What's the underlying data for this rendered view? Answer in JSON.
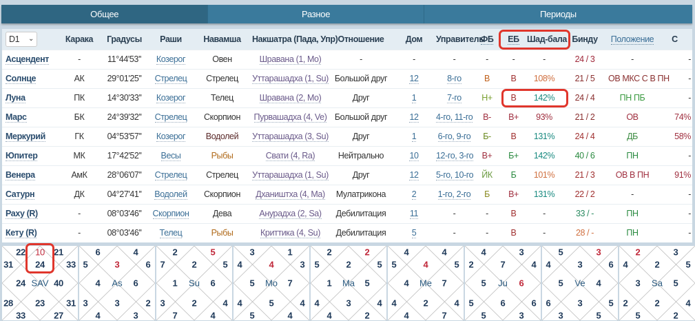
{
  "tabs": [
    {
      "label": "Общее",
      "active": true
    },
    {
      "label": "Разное",
      "active": false
    },
    {
      "label": "Периоды",
      "active": false
    }
  ],
  "division_select": {
    "value": "D1",
    "icon": "chevron-down-icon"
  },
  "columns": [
    "Карака",
    "Градусы",
    "Раши",
    "Навамша",
    "Накшатра (Пада, Упр)",
    "Отношение",
    "Дом",
    "Управитель",
    "ФБ",
    "ЕБ",
    "Шад-бала",
    "Бинду",
    "Положение",
    "С"
  ],
  "rows": [
    {
      "planet": "Асцендент",
      "karaka": "-",
      "deg": "11°44'53''",
      "rashi": "Козерог",
      "navamsha": {
        "t": "Овен",
        "c": "#333333"
      },
      "nakshatra": "Шравана (1, Mo)",
      "relation": "-",
      "house": "-",
      "lord": "-",
      "fb": {
        "t": "-",
        "c": "#333333"
      },
      "eb": {
        "t": "-",
        "c": "#333333"
      },
      "shad": {
        "t": "-",
        "c": "#333333"
      },
      "bindu": {
        "t": "24 / 3",
        "c": "#a0283a"
      },
      "pol": {
        "t": "-",
        "c": "#333333"
      },
      "s": {
        "t": "-",
        "c": "#333333"
      }
    },
    {
      "planet": "Солнце",
      "karaka": "АК",
      "deg": "29°01'25''",
      "rashi": "Стрелец",
      "navamsha": {
        "t": "Стрелец",
        "c": "#333333"
      },
      "nakshatra": "Уттарашадха (1, Su)",
      "relation": "Большой друг",
      "house": "12",
      "lord": "8-го",
      "fb": {
        "t": "В",
        "c": "#c0601a"
      },
      "eb": {
        "t": "В",
        "c": "#a03030"
      },
      "shad": {
        "t": "108%",
        "c": "#d07040"
      },
      "bindu": {
        "t": "21 / 5",
        "c": "#8a3030"
      },
      "pol": {
        "t": "ОВ МКС С В ПН",
        "c": "#8a3030"
      },
      "s": {
        "t": "-",
        "c": "#333333"
      }
    },
    {
      "planet": "Луна",
      "karaka": "ПК",
      "deg": "14°30'33''",
      "rashi": "Козерог",
      "navamsha": {
        "t": "Телец",
        "c": "#333333"
      },
      "nakshatra": "Шравана (2, Mo)",
      "relation": "Друг",
      "house": "1",
      "lord": "7-го",
      "fb": {
        "t": "Н+",
        "c": "#7aa030"
      },
      "eb": {
        "t": "В",
        "c": "#a03030"
      },
      "shad": {
        "t": "142%",
        "c": "#1a8a80"
      },
      "bindu": {
        "t": "24 / 4",
        "c": "#8a3030"
      },
      "pol": {
        "t": "ПН ПБ",
        "c": "#3a9a40"
      },
      "s": {
        "t": "-",
        "c": "#333333"
      }
    },
    {
      "planet": "Марс",
      "karaka": "БК",
      "deg": "24°39'32''",
      "rashi": "Стрелец",
      "navamsha": {
        "t": "Скорпион",
        "c": "#333333"
      },
      "nakshatra": "Пурвашадха (4, Ve)",
      "relation": "Большой друг",
      "house": "12",
      "lord": "4-го, 11-го",
      "fb": {
        "t": "В-",
        "c": "#a03040"
      },
      "eb": {
        "t": "В+",
        "c": "#a03040"
      },
      "shad": {
        "t": "93%",
        "c": "#a03040"
      },
      "bindu": {
        "t": "21 / 2",
        "c": "#8a3030"
      },
      "pol": {
        "t": "ОВ",
        "c": "#a03040"
      },
      "s": {
        "t": "74%",
        "c": "#a03040"
      }
    },
    {
      "planet": "Меркурий",
      "karaka": "ГК",
      "deg": "04°53'57''",
      "rashi": "Козерог",
      "navamsha": {
        "t": "Водолей",
        "c": "#5a2a2a"
      },
      "nakshatra": "Уттарашадха (3, Su)",
      "relation": "Друг",
      "house": "1",
      "lord": "6-го, 9-го",
      "fb": {
        "t": "Б-",
        "c": "#6a8a20"
      },
      "eb": {
        "t": "В",
        "c": "#a03030"
      },
      "shad": {
        "t": "131%",
        "c": "#1a8a80"
      },
      "bindu": {
        "t": "24 / 4",
        "c": "#a03030"
      },
      "pol": {
        "t": "ДБ",
        "c": "#3a8a40"
      },
      "s": {
        "t": "58%",
        "c": "#a03040"
      }
    },
    {
      "planet": "Юпитер",
      "karaka": "МК",
      "deg": "17°42'52''",
      "rashi": "Весы",
      "navamsha": {
        "t": "Рыбы",
        "c": "#b06a1a"
      },
      "nakshatra": "Свати (4, Ra)",
      "relation": "Нейтрально",
      "house": "10",
      "lord": "12-го, 3-го",
      "fb": {
        "t": "В+",
        "c": "#a03040"
      },
      "eb": {
        "t": "Б+",
        "c": "#2a8a40"
      },
      "shad": {
        "t": "142%",
        "c": "#1a8a80"
      },
      "bindu": {
        "t": "40 / 6",
        "c": "#2a8a40"
      },
      "pol": {
        "t": "ПН",
        "c": "#2a8a40"
      },
      "s": {
        "t": "-",
        "c": "#333333"
      }
    },
    {
      "planet": "Венера",
      "karaka": "АмК",
      "deg": "28°06'07''",
      "rashi": "Стрелец",
      "navamsha": {
        "t": "Стрелец",
        "c": "#333333"
      },
      "nakshatra": "Уттарашадха (1, Su)",
      "relation": "Друг",
      "house": "12",
      "lord": "5-го, 10-го",
      "fb": {
        "t": "ЙК",
        "c": "#6a9a40"
      },
      "eb": {
        "t": "Б",
        "c": "#2a8a40"
      },
      "shad": {
        "t": "101%",
        "c": "#d07040"
      },
      "bindu": {
        "t": "21 / 3",
        "c": "#a03030"
      },
      "pol": {
        "t": "ОВ В ПН",
        "c": "#a03040"
      },
      "s": {
        "t": "91%",
        "c": "#a03040"
      }
    },
    {
      "planet": "Сатурн",
      "karaka": "ДК",
      "deg": "04°27'41''",
      "rashi": "Водолей",
      "navamsha": {
        "t": "Скорпион",
        "c": "#333333"
      },
      "nakshatra": "Дхаништха (4, Ma)",
      "relation": "Мулатрикона",
      "house": "2",
      "lord": "1-го, 2-го",
      "fb": {
        "t": "Б",
        "c": "#8a8a20"
      },
      "eb": {
        "t": "В+",
        "c": "#a03040"
      },
      "shad": {
        "t": "131%",
        "c": "#1a8a80"
      },
      "bindu": {
        "t": "22 / 2",
        "c": "#a03030"
      },
      "pol": {
        "t": "-",
        "c": "#333333"
      },
      "s": {
        "t": "-",
        "c": "#333333"
      }
    },
    {
      "planet": "Раху (R)",
      "karaka": "-",
      "deg": "08°03'46''",
      "rashi": "Скорпион",
      "navamsha": {
        "t": "Дева",
        "c": "#333333"
      },
      "nakshatra": "Анурадха (2, Sa)",
      "relation": "Дебилитация",
      "house": "11",
      "lord": "-",
      "fb": {
        "t": "-",
        "c": "#333333"
      },
      "eb": {
        "t": "В",
        "c": "#a03030"
      },
      "shad": {
        "t": "-",
        "c": "#333333"
      },
      "bindu": {
        "t": "33 / -",
        "c": "#2a8a60"
      },
      "pol": {
        "t": "ПН",
        "c": "#2a8a40"
      },
      "s": {
        "t": "-",
        "c": "#333333"
      }
    },
    {
      "planet": "Кету (R)",
      "karaka": "-",
      "deg": "08°03'46''",
      "rashi": "Телец",
      "navamsha": {
        "t": "Рыбы",
        "c": "#b06a1a"
      },
      "nakshatra": "Криттика (4, Su)",
      "relation": "Дебилитация",
      "house": "5",
      "lord": "-",
      "fb": {
        "t": "-",
        "c": "#333333"
      },
      "eb": {
        "t": "В",
        "c": "#a03030"
      },
      "shad": {
        "t": "-",
        "c": "#333333"
      },
      "bindu": {
        "t": "28 / -",
        "c": "#d07040"
      },
      "pol": {
        "t": "ПН",
        "c": "#2a8a40"
      },
      "s": {
        "t": "-",
        "c": "#333333"
      }
    }
  ],
  "charts": [
    {
      "label": "SAV",
      "sign": "10",
      "houses": [
        24,
        22,
        31,
        24,
        28,
        33,
        23,
        27,
        31,
        40,
        33,
        21
      ],
      "red_house": 0
    },
    {
      "label": "As",
      "houses": [
        3,
        6,
        5,
        4,
        3,
        4,
        3,
        3,
        2,
        6,
        6,
        4
      ],
      "red_house": 1
    },
    {
      "label": "Su",
      "houses": [
        2,
        2,
        7,
        1,
        3,
        7,
        2,
        4,
        4,
        6,
        5,
        5
      ],
      "red_house": 12
    },
    {
      "label": "Mo",
      "houses": [
        4,
        3,
        4,
        5,
        4,
        5,
        5,
        4,
        4,
        7,
        3,
        1
      ],
      "red_house": 1
    },
    {
      "label": "Ma",
      "houses": [
        2,
        2,
        5,
        1,
        4,
        4,
        3,
        2,
        4,
        5,
        5,
        2
      ],
      "red_house": 12
    },
    {
      "label": "Me",
      "houses": [
        4,
        4,
        5,
        4,
        4,
        4,
        2,
        7,
        4,
        7,
        5,
        4
      ],
      "red_house": 1
    },
    {
      "label": "Ju",
      "houses": [
        7,
        4,
        2,
        5,
        5,
        5,
        6,
        3,
        6,
        6,
        4,
        3
      ],
      "red_house": 10
    },
    {
      "label": "Ve",
      "houses": [
        3,
        5,
        4,
        5,
        6,
        3,
        3,
        5,
        5,
        4,
        6,
        3
      ],
      "red_house": 12
    },
    {
      "label": "Sa",
      "houses": [
        2,
        2,
        4,
        3,
        2,
        5,
        2,
        2,
        4,
        5,
        5,
        3
      ],
      "red_house": 2
    }
  ],
  "accent_colors": {
    "tab_bar": "#3a7a9c",
    "tab_active": "#2f6682",
    "highlight": "#e0362c",
    "red_number": "#c0283a"
  }
}
